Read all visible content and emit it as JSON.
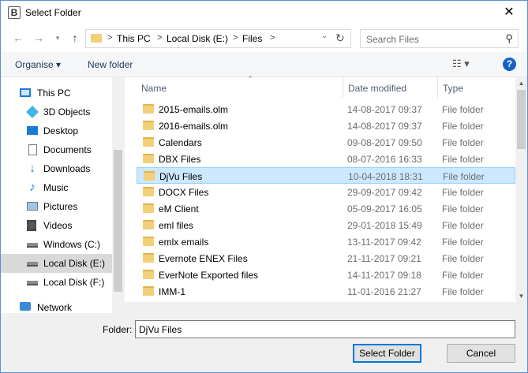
{
  "window": {
    "title": "Select Folder",
    "app_icon": "B",
    "close_glyph": "✕"
  },
  "address": {
    "crumbs": [
      "This PC",
      "Local Disk (E:)",
      "Files"
    ],
    "separator": ">"
  },
  "search": {
    "placeholder": "Search Files"
  },
  "toolbar": {
    "organise": "Organise ▾",
    "new_folder": "New folder",
    "view_glyph": "☷ ▾",
    "help": "?"
  },
  "nav": {
    "items": [
      {
        "label": "This PC",
        "icon": "computer-icon"
      },
      {
        "label": "3D Objects",
        "icon": "cube-icon"
      },
      {
        "label": "Desktop",
        "icon": "desktop-icon"
      },
      {
        "label": "Documents",
        "icon": "document-icon"
      },
      {
        "label": "Downloads",
        "icon": "download-icon"
      },
      {
        "label": "Music",
        "icon": "music-icon"
      },
      {
        "label": "Pictures",
        "icon": "picture-icon"
      },
      {
        "label": "Videos",
        "icon": "video-icon"
      },
      {
        "label": "Windows (C:)",
        "icon": "drive-icon"
      },
      {
        "label": "Local Disk (E:)",
        "icon": "drive-icon"
      },
      {
        "label": "Local Disk (F:)",
        "icon": "drive-icon"
      },
      {
        "label": "Network",
        "icon": "network-icon"
      }
    ],
    "selected": "Local Disk (E:)"
  },
  "columns": {
    "name": "Name",
    "date": "Date modified",
    "type": "Type"
  },
  "files": [
    {
      "name": "2015-emails.olm",
      "date": "14-08-2017 09:37",
      "type": "File folder"
    },
    {
      "name": "2016-emails.olm",
      "date": "14-08-2017 09:37",
      "type": "File folder"
    },
    {
      "name": "Calendars",
      "date": "09-08-2017 09:50",
      "type": "File folder"
    },
    {
      "name": "DBX Files",
      "date": "08-07-2016 16:33",
      "type": "File folder"
    },
    {
      "name": "DjVu Files",
      "date": "10-04-2018 18:31",
      "type": "File folder"
    },
    {
      "name": "DOCX Files",
      "date": "29-09-2017 09:42",
      "type": "File folder"
    },
    {
      "name": "eM Client",
      "date": "05-09-2017 16:05",
      "type": "File folder"
    },
    {
      "name": "eml files",
      "date": "29-01-2018 15:49",
      "type": "File folder"
    },
    {
      "name": "emlx emails",
      "date": "13-11-2017 09:42",
      "type": "File folder"
    },
    {
      "name": "Evernote ENEX Files",
      "date": "21-11-2017 09:21",
      "type": "File folder"
    },
    {
      "name": "EverNote Exported files",
      "date": "14-11-2017 09:18",
      "type": "File folder"
    },
    {
      "name": "IMM-1",
      "date": "11-01-2016 21:27",
      "type": "File folder"
    }
  ],
  "selected_file": "DjVu Files",
  "footer": {
    "folder_label": "Folder:",
    "folder_value": "DjVu Files",
    "select_button": "Select Folder",
    "cancel_button": "Cancel"
  },
  "colors": {
    "accent": "#0078d7",
    "selection": "#cce8ff",
    "folder": "#f1d078"
  }
}
